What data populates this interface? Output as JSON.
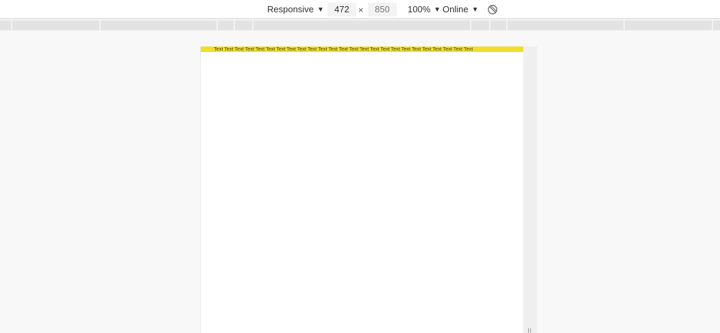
{
  "toolbar": {
    "device_label": "Responsive",
    "width_value": "472",
    "times_symbol": "×",
    "height_value": "850",
    "zoom_label": "100%",
    "throttle_label": "Online",
    "caret": "▼"
  },
  "icons": {
    "rotate": "rotate-icon"
  },
  "viewport": {
    "banner_text": "Text Text Text Text Text Text Text Text Text Text Text Text Text Text Text Text Text Text Text Text Text Text Text Text Text",
    "banner_color": "#f0de2b"
  }
}
